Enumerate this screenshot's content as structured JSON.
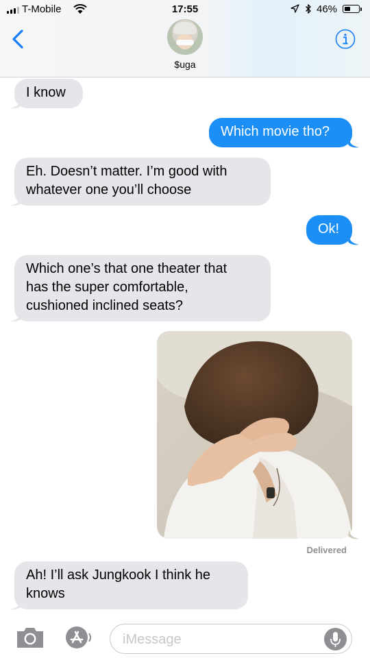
{
  "status": {
    "carrier": "T-Mobile",
    "time": "17:55",
    "battery_percent": "46%",
    "battery_level": 0.46,
    "signal_bars": 3
  },
  "header": {
    "contact_name": "$uga",
    "back_icon": "chevron-left-icon",
    "info_icon": "info-icon"
  },
  "messages": [
    {
      "from": "them",
      "text": "I know"
    },
    {
      "from": "me",
      "text": "Which movie tho?"
    },
    {
      "from": "them",
      "lines": [
        "Eh. Doesn’t matter. I’m good with",
        "whatever one you’ll choose"
      ]
    },
    {
      "from": "me",
      "text": "Ok!"
    },
    {
      "from": "them",
      "lines": [
        "Which one’s that one theater that",
        "has the super comfortable,",
        "cushioned inclined seats?"
      ]
    },
    {
      "from": "me",
      "type": "image"
    },
    {
      "from": "them",
      "lines": [
        "Ah! I’ll ask Jungkook I think he",
        "knows"
      ]
    }
  ],
  "delivered_label": "Delivered",
  "input": {
    "placeholder": "iMessage",
    "value": ""
  },
  "colors": {
    "sent_bubble": "#1b8ff5",
    "received_bubble": "#e5e5ea",
    "accent": "#157efb",
    "meta_text": "#8e8e93"
  }
}
